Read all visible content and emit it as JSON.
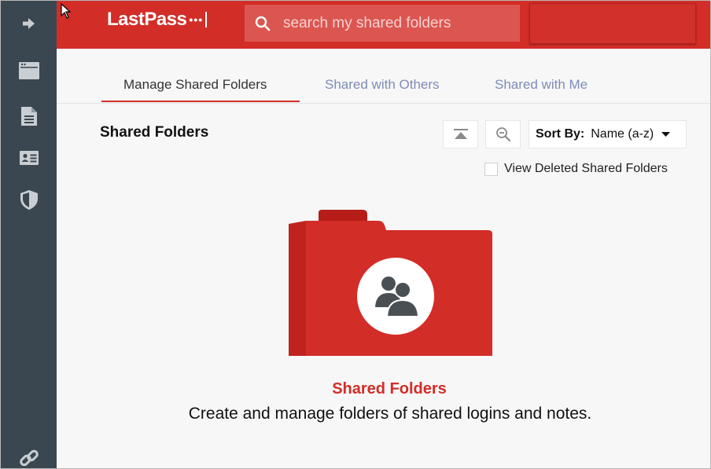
{
  "brand": {
    "name": "LastPass",
    "dots": "•••",
    "accent": "#d32d27"
  },
  "sidebar": {
    "items": [
      {
        "icon": "arrow-right-icon"
      },
      {
        "icon": "browser-window-icon"
      },
      {
        "icon": "note-document-icon"
      },
      {
        "icon": "address-card-icon"
      },
      {
        "icon": "shield-icon"
      },
      {
        "icon": "link-icon"
      }
    ]
  },
  "search": {
    "placeholder": "search my shared folders",
    "value": ""
  },
  "tabs": [
    {
      "label": "Manage Shared Folders",
      "active": true
    },
    {
      "label": "Shared with Others",
      "active": false
    },
    {
      "label": "Shared with Me",
      "active": false
    }
  ],
  "main": {
    "heading": "Shared Folders",
    "sort_label": "Sort By:",
    "sort_value": "Name (a-z)",
    "view_deleted_label": "View Deleted Shared Folders",
    "view_deleted_checked": false,
    "empty_title": "Shared Folders",
    "empty_description": "Create and manage folders of shared logins and notes."
  }
}
